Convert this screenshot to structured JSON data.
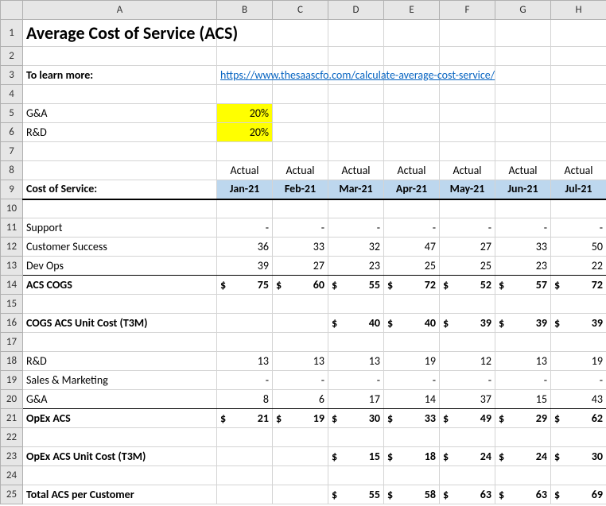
{
  "colHeaders": [
    "A",
    "B",
    "C",
    "D",
    "E",
    "F",
    "G",
    "H"
  ],
  "rowCount": 25,
  "title": "Average Cost of Service (ACS)",
  "learnMoreLabel": "To learn more:",
  "learnMoreUrl": "https://www.thesaascfo.com/calculate-average-cost-service/",
  "assumptions": {
    "ga_label": "G&A",
    "ga_pct": "20%",
    "rd_label": "R&D",
    "rd_pct": "20%"
  },
  "periodTypeRow": [
    "Actual",
    "Actual",
    "Actual",
    "Actual",
    "Actual",
    "Actual",
    "Actual"
  ],
  "months": [
    "Jan-21",
    "Feb-21",
    "Mar-21",
    "Apr-21",
    "May-21",
    "Jun-21",
    "Jul-21"
  ],
  "costOfServiceLabel": "Cost of Service:",
  "lines": {
    "support": {
      "label": "Support",
      "vals": [
        "-",
        "-",
        "-",
        "-",
        "-",
        "-",
        "-"
      ]
    },
    "cs": {
      "label": "Customer Success",
      "vals": [
        "36",
        "33",
        "32",
        "47",
        "27",
        "33",
        "50"
      ]
    },
    "devops": {
      "label": "Dev Ops",
      "vals": [
        "39",
        "27",
        "23",
        "25",
        "25",
        "23",
        "22"
      ]
    },
    "acs_cogs": {
      "label": "ACS COGS",
      "vals": [
        "75",
        "60",
        "55",
        "72",
        "52",
        "57",
        "72"
      ]
    },
    "cogs_unit": {
      "label": "COGS ACS Unit Cost (T3M)",
      "vals": [
        "",
        "",
        "40",
        "40",
        "39",
        "39",
        "39"
      ]
    },
    "rd": {
      "label": "R&D",
      "vals": [
        "13",
        "13",
        "13",
        "19",
        "12",
        "13",
        "19"
      ]
    },
    "sm": {
      "label": "Sales & Marketing",
      "vals": [
        "-",
        "-",
        "-",
        "-",
        "-",
        "-",
        "-"
      ]
    },
    "ga": {
      "label": "G&A",
      "vals": [
        "8",
        "6",
        "17",
        "14",
        "37",
        "15",
        "43"
      ]
    },
    "opex": {
      "label": "OpEx ACS",
      "vals": [
        "21",
        "19",
        "30",
        "33",
        "49",
        "29",
        "62"
      ]
    },
    "opex_unit": {
      "label": "OpEx ACS Unit Cost (T3M)",
      "vals": [
        "",
        "",
        "15",
        "18",
        "24",
        "24",
        "30"
      ]
    },
    "total": {
      "label": "Total ACS per Customer",
      "vals": [
        "",
        "",
        "55",
        "58",
        "63",
        "63",
        "69"
      ]
    }
  }
}
